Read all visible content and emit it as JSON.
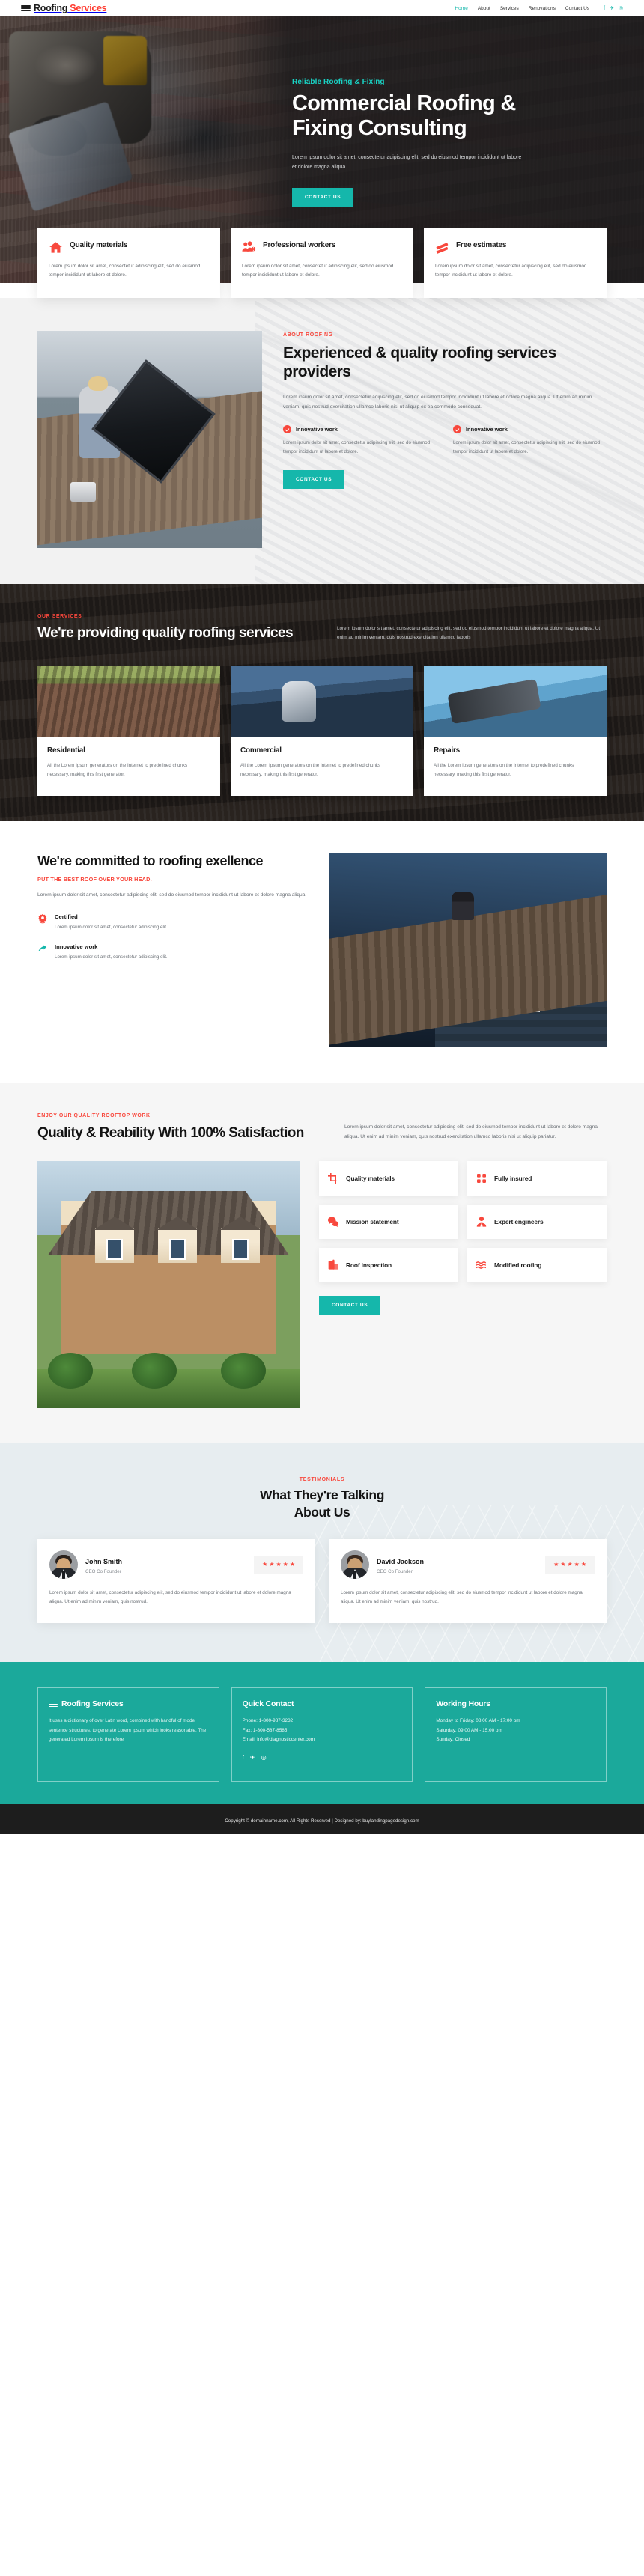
{
  "brand": {
    "name_primary": "Roofing",
    "name_accent": "Services",
    "logo_icon": "waves-icon",
    "accent_red": "#f8483d",
    "accent_teal": "#15b7ab",
    "dark": "#171717"
  },
  "nav": {
    "items": [
      {
        "label": "Home",
        "active": true
      },
      {
        "label": "About",
        "active": false
      },
      {
        "label": "Services",
        "active": false
      },
      {
        "label": "Renovations",
        "active": false
      },
      {
        "label": "Contact Us",
        "active": false
      }
    ],
    "social": [
      {
        "name": "facebook-icon",
        "glyph": "f"
      },
      {
        "name": "twitter-icon",
        "glyph": "✈"
      },
      {
        "name": "instagram-icon",
        "glyph": "◎"
      }
    ]
  },
  "hero": {
    "eyebrow": "Reliable Roofing & Fixing",
    "title_line1": "Commercial Roofing &",
    "title_line2": "Fixing Consulting",
    "paragraph": "Lorem ipsum dolor sit amet, consectetur adipiscing elit, sed do eiusmod tempor incididunt ut labore et dolore magna aliqua.",
    "cta": "CONTACT US"
  },
  "features": [
    {
      "icon": "home-icon",
      "title": "Quality materials",
      "text": "Lorem ipsum dolor sit amet, consectetur adipiscing elit, sed do eiusmod tempor incididunt ut labore et dolore."
    },
    {
      "icon": "workers-icon",
      "title": "Professional workers",
      "text": "Lorem ipsum dolor sit amet, consectetur adipiscing elit, sed do eiusmod tempor incididunt ut labore et dolore."
    },
    {
      "icon": "estimate-icon",
      "title": "Free estimates",
      "text": "Lorem ipsum dolor sit amet, consectetur adipiscing elit, sed do eiusmod tempor incididunt ut labore et dolore."
    }
  ],
  "about": {
    "eyebrow": "ABOUT ROOFING",
    "title": "Experienced & quality roofing services providers",
    "paragraph": "Lorem ipsum dolor sit amet, consectetur adipiscing elit, sed do eiusmod tempor incididunt ut labore et dolore magna aliqua. Ut enim ad minim veniam, quis nostrud exercitation ullamco laboris nisi ut aliquip ex ea commodo consequat.",
    "points": [
      {
        "title": "Innovative work",
        "text": "Lorem ipsum dolor sit amet, consectetur adipiscing elit, sed do eiusmod tempor incididunt ut labore et dolore."
      },
      {
        "title": "Innovative work",
        "text": "Lorem ipsum dolor sit amet, consectetur adipiscing elit, sed do eiusmod tempor incididunt ut labore et dolore."
      }
    ],
    "cta": "CONTACT US",
    "image_alt": "worker-installing-solar-panel-on-roof"
  },
  "services": {
    "eyebrow": "OUR SERVICES",
    "title": "We're providing quality roofing services",
    "paragraph": "Lorem ipsum dolor sit amet, consectetur adipiscing elit, sed do eiusmod tempor incididunt ut labore et dolore magna aliqua. Ut enim ad minim veniam, quis nostrud exercitation ullamco laboris",
    "cards": [
      {
        "title": "Residential",
        "text": "All the Lorem Ipsum generators on the Internet to predefined chunks necessary, making this first generator.",
        "image_alt": "residential-tile-roof"
      },
      {
        "title": "Commercial",
        "text": "All the Lorem Ipsum generators on the Internet to predefined chunks necessary, making this first generator.",
        "image_alt": "commercial-roofer-working"
      },
      {
        "title": "Repairs",
        "text": "All the Lorem Ipsum generators on the Internet to predefined chunks necessary, making this first generator.",
        "image_alt": "roof-repair-nailgun"
      }
    ]
  },
  "committed": {
    "title": "We're committed to roofing exellence",
    "subtitle": "PUT THE BEST ROOF OVER YOUR HEAD.",
    "paragraph": "Lorem ipsum dolor sit amet, consectetur adipiscing elit, sed do eiusmod tempor incididunt ut labore et dolore magna aliqua.",
    "items": [
      {
        "icon": "badge-icon",
        "title": "Certified",
        "text": "Lorem ipsum dolor sit amet, consectetur adipiscing elit."
      },
      {
        "icon": "innovation-icon",
        "title": "Innovative work",
        "text": "Lorem ipsum dolor sit amet, consectetur adipiscing elit."
      }
    ],
    "image_alt": "workers-on-house-roof"
  },
  "quality": {
    "eyebrow": "ENJOY OUR QUALITY ROOFTOP WORK",
    "title": "Quality & Reability With 100% Satisfaction",
    "paragraph": "Lorem ipsum dolor sit amet, consectetur adipiscing elit, sed do eiusmod tempor incididunt ut labore et dolore magna aliqua. Ut enim ad minim veniam, quis nostrud exercitation ullamco laboris nisi ut aliquip pariatur.",
    "image_alt": "suburban-house-with-new-roof",
    "cta": "CONTACT US",
    "items": [
      {
        "icon": "crop-icon",
        "label": "Quality materials"
      },
      {
        "icon": "grid-dots-icon",
        "label": "Fully insured"
      },
      {
        "icon": "chat-bubbles-icon",
        "label": "Mission statement"
      },
      {
        "icon": "engineer-icon",
        "label": "Expert engineers"
      },
      {
        "icon": "clipboard-icon",
        "label": "Roof inspection"
      },
      {
        "icon": "waves-icon",
        "label": "Modified roofing"
      }
    ]
  },
  "testimonials": {
    "eyebrow": "TESTIMONIALS",
    "title_line1": "What They're Talking",
    "title_line2": "About Us",
    "cards": [
      {
        "name": "John Smith",
        "role": "CEO Co Founder",
        "rating": 5,
        "stars": "★★★★★",
        "text": "Lorem ipsum dolor sit amet, consectetur adipiscing elit, sed do eiusmod tempor incididunt ut labore et dolore magna aliqua. Ut enim ad minim veniam, quis nostrud."
      },
      {
        "name": "David Jackson",
        "role": "CEO Co Founder",
        "rating": 5,
        "stars": "★★★★★",
        "text": "Lorem ipsum dolor sit amet, consectetur adipiscing elit, sed do eiusmod tempor incididunt ut labore et dolore magna aliqua. Ut enim ad minim veniam, quis nostrud."
      }
    ]
  },
  "footer": {
    "about": {
      "title": "Roofing Services",
      "text": "It uses a dictionary of over Latin word, combined with handful of model sentence structures, to generate Lorem Ipsum which looks reasonable. The generated Lorem Ipsum is therefore"
    },
    "contact": {
      "title": "Quick Contact",
      "phone": "Phone: 1-800-987-3232",
      "fax": "Fax: 1-800-587-8585",
      "email": "Email: info@diagnosticcenter.com",
      "social": [
        {
          "name": "facebook-icon",
          "glyph": "f"
        },
        {
          "name": "twitter-icon",
          "glyph": "✈"
        },
        {
          "name": "instagram-icon",
          "glyph": "◎"
        }
      ]
    },
    "hours": {
      "title": "Working Hours",
      "line1": "Monday to Friday: 08:00 AM - 17:00 pm",
      "line2": "Saturday: 09:00 AM - 15:00 pm",
      "line3": "Sunday: Closed"
    },
    "copyright": "Copyright © domainname.com, All Rights Reserved | Designed by: buylandingpagedesign.com"
  }
}
